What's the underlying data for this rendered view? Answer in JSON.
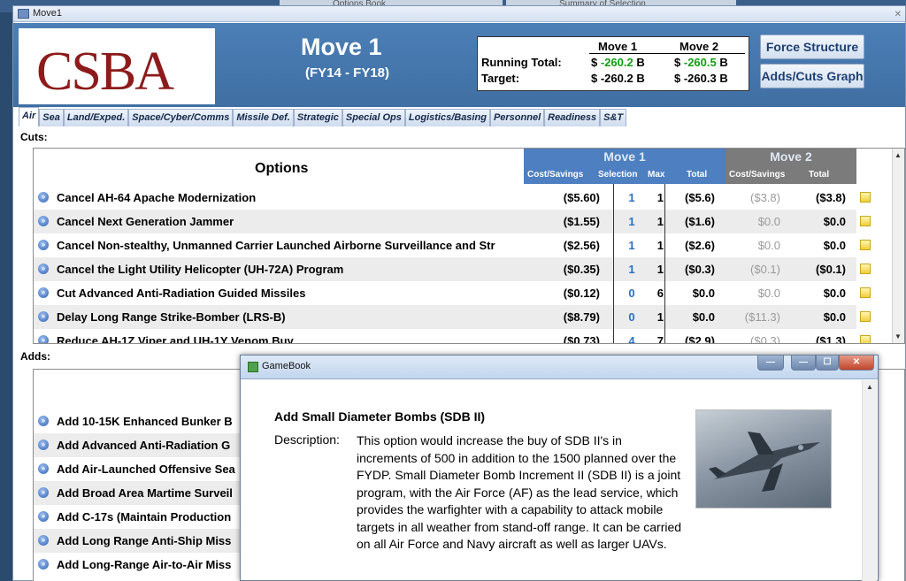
{
  "window": {
    "title": "Move1"
  },
  "background_strip": {
    "ghost_left": "Options Book",
    "ghost_right": "Summary of Selection"
  },
  "header": {
    "logo": "CSBA",
    "move_title": "Move 1",
    "move_years": "(FY14 - FY18)",
    "totals": {
      "col1": "Move 1",
      "col2": "Move 2",
      "running_label": "Running Total:",
      "target_label": "Target:",
      "running_m1_sign": "$",
      "running_m1": "-260.2",
      "running_m1_unit": "B",
      "running_m2_sign": "$",
      "running_m2": "-260.5",
      "running_m2_unit": "B",
      "target_m1": "$  -260.2 B",
      "target_m2": "$  -260.3 B"
    },
    "buttons": {
      "force_structure": "Force Structure",
      "adds_cuts_graph": "Adds/Cuts Graph"
    }
  },
  "tabs": [
    "Air",
    "Sea",
    "Land/Exped.",
    "Space/Cyber/Comms",
    "Missile Def.",
    "Strategic",
    "Special Ops",
    "Logistics/Basing",
    "Personnel",
    "Readiness",
    "S&T"
  ],
  "active_tab": "Air",
  "cuts": {
    "label": "Cuts:",
    "options_header": "Options",
    "move1": {
      "title": "Move 1",
      "cost_savings": "Cost/Savings",
      "selection": "Selection",
      "max": "Max",
      "total": "Total"
    },
    "move2": {
      "title": "Move 2",
      "cost_savings": "Cost/Savings",
      "total": "Total"
    },
    "rows": [
      {
        "name": "Cancel AH-64 Apache Modernization",
        "cost": "($5.60)",
        "selection": "1",
        "max": "1",
        "total": "($5.6)",
        "m2_cost": "($3.8)",
        "m2_total": "($3.8)"
      },
      {
        "name": "Cancel Next Generation Jammer",
        "cost": "($1.55)",
        "selection": "1",
        "max": "1",
        "total": "($1.6)",
        "m2_cost": "$0.0",
        "m2_total": "$0.0"
      },
      {
        "name": "Cancel Non-stealthy, Unmanned Carrier Launched Airborne Surveillance and Str",
        "cost": "($2.56)",
        "selection": "1",
        "max": "1",
        "total": "($2.6)",
        "m2_cost": "$0.0",
        "m2_total": "$0.0"
      },
      {
        "name": "Cancel the Light Utility Helicopter (UH-72A) Program",
        "cost": "($0.35)",
        "selection": "1",
        "max": "1",
        "total": "($0.3)",
        "m2_cost": "($0.1)",
        "m2_total": "($0.1)"
      },
      {
        "name": "Cut Advanced Anti-Radiation Guided Missiles",
        "cost": "($0.12)",
        "selection": "0",
        "max": "6",
        "total": "$0.0",
        "m2_cost": "$0.0",
        "m2_total": "$0.0"
      },
      {
        "name": "Delay Long Range Strike-Bomber (LRS-B)",
        "cost": "($8.79)",
        "selection": "0",
        "max": "1",
        "total": "$0.0",
        "m2_cost": "($11.3)",
        "m2_total": "$0.0"
      },
      {
        "name": "Reduce AH-1Z Viper and UH-1Y Venom Buy",
        "cost": "($0.73)",
        "selection": "4",
        "max": "7",
        "total": "($2.9)",
        "m2_cost": "($0.3)",
        "m2_total": "($1.3)"
      }
    ]
  },
  "adds": {
    "label": "Adds:",
    "rows": [
      {
        "name": "Add 10-15K Enhanced Bunker B"
      },
      {
        "name": "Add Advanced Anti-Radiation G"
      },
      {
        "name": "Add Air-Launched Offensive Sea"
      },
      {
        "name": "Add Broad Area Martime Surveil"
      },
      {
        "name": "Add C-17s (Maintain Production"
      },
      {
        "name": "Add Long Range Anti-Ship Miss"
      },
      {
        "name": "Add Long-Range Air-to-Air Miss"
      }
    ]
  },
  "dialog": {
    "title": "GameBook",
    "heading": "Add Small Diameter Bombs (SDB II)",
    "description_label": "Description:",
    "description": "This option would increase the buy of SDB II's in increments of 500 in addition to the 1500 planned over the FYDP. Small Diameter Bomb Increment II (SDB II) is a joint program, with the Air Force (AF) as the lead service, which provides the warfighter with a capability to attack mobile targets in all weather from stand-off range. It can be carried on all Air Force and Navy aircraft as well as larger UAVs."
  },
  "colors": {
    "header_blue": "#4c7fb7",
    "move1_blue": "#4d7fc1",
    "move2_gray": "#7b7b7b",
    "logo_red": "#8d1b1b",
    "green": "#10a010"
  }
}
